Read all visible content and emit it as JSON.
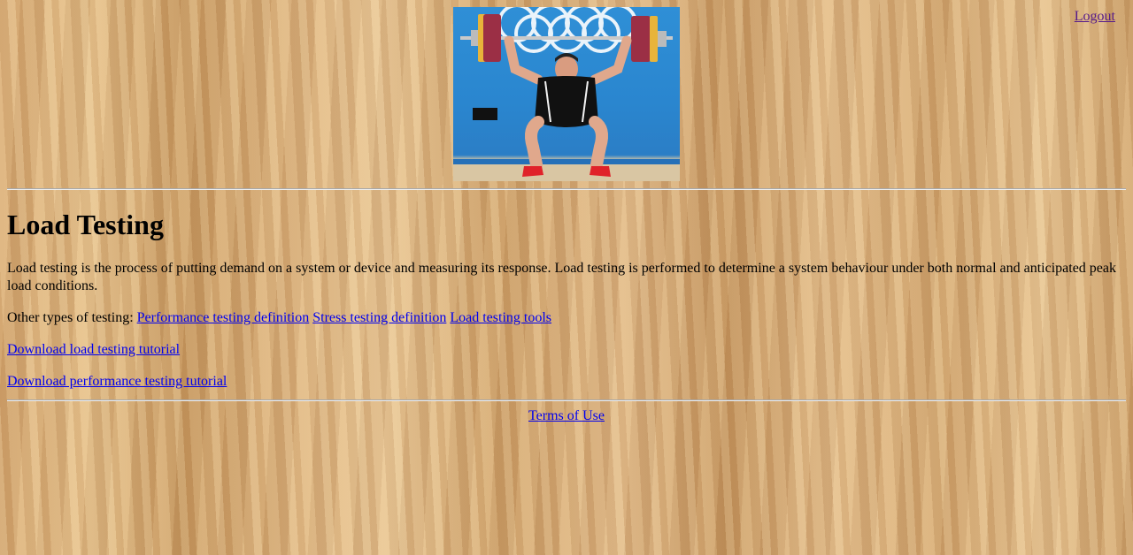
{
  "header": {
    "logout_label": "Logout",
    "image_alt": "Weightlifter holding a barbell overhead"
  },
  "main": {
    "title": "Load Testing",
    "intro": "Load testing is the process of putting demand on a system or device and measuring its response. Load testing is performed to determine a system behaviour under both normal and anticipated peak load conditions.",
    "other_types_label": "Other types of testing:",
    "other_links": [
      {
        "label": "Performance testing definition"
      },
      {
        "label": "Stress testing definition"
      },
      {
        "label": "Load testing tools"
      }
    ],
    "download_load_label": "Download load testing tutorial",
    "download_performance_label": "Download performance testing tutorial"
  },
  "footer": {
    "terms_label": "Terms of Use"
  },
  "colors": {
    "link": "#0000ee",
    "visited_link": "#551a8b",
    "text": "#000000"
  }
}
